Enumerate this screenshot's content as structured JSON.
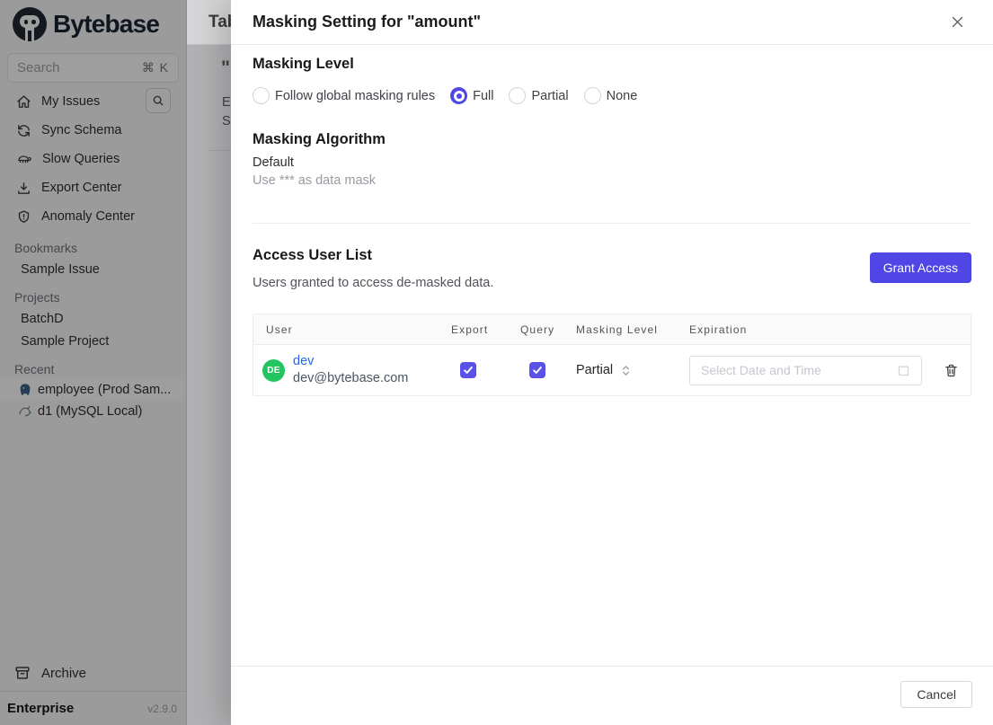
{
  "colors": {
    "accent": "#4f46e5",
    "checkbox": "#5a51e8",
    "link_blue": "#2563eb",
    "avatar_green": "#22c55e",
    "postgres_blue": "#39618d",
    "mysql_teal": "#5b7a8c"
  },
  "sidebar": {
    "logo_text": "Bytebase",
    "search": {
      "placeholder": "Search",
      "shortcut": "⌘ K"
    },
    "menu": [
      {
        "label": "My Issues",
        "icon": "home-icon"
      },
      {
        "label": "Sync Schema",
        "icon": "sync-icon"
      },
      {
        "label": "Slow Queries",
        "icon": "turtle-icon"
      },
      {
        "label": "Export Center",
        "icon": "download-icon"
      },
      {
        "label": "Anomaly Center",
        "icon": "shield-icon"
      }
    ],
    "bookmarks_label": "Bookmarks",
    "bookmarks": [
      {
        "label": "Sample Issue"
      }
    ],
    "projects_label": "Projects",
    "projects": [
      {
        "label": "BatchD"
      },
      {
        "label": "Sample Project"
      }
    ],
    "recent_label": "Recent",
    "recent": [
      {
        "label": "employee (Prod Sam...",
        "icon": "postgres-icon",
        "selected": true
      },
      {
        "label": "d1 (MySQL Local)",
        "icon": "mysql-icon",
        "selected": false
      }
    ],
    "archive_label": "Archive",
    "plan": "Enterprise",
    "version": "v2.9.0"
  },
  "background_page": {
    "title_fragment": "Tab",
    "quote_fragment": "\"",
    "line2_fragment": "E",
    "line3_fragment": "S"
  },
  "dialog": {
    "title": "Masking Setting for \"amount\"",
    "masking_level": {
      "heading": "Masking Level",
      "options": [
        {
          "label": "Follow global masking rules",
          "selected": false
        },
        {
          "label": "Full",
          "selected": true
        },
        {
          "label": "Partial",
          "selected": false
        },
        {
          "label": "None",
          "selected": false
        }
      ]
    },
    "masking_algorithm": {
      "heading": "Masking Algorithm",
      "name": "Default",
      "description": "Use *** as data mask"
    },
    "access_user_list": {
      "heading": "Access User List",
      "subtitle": "Users granted to access de-masked data.",
      "grant_button": "Grant Access",
      "table": {
        "columns": [
          "User",
          "Export",
          "Query",
          "Masking Level",
          "Expiration"
        ],
        "rows": [
          {
            "avatar": "DE",
            "name": "dev",
            "email": "dev@bytebase.com",
            "export_checked": true,
            "query_checked": true,
            "masking_level": "Partial",
            "expiration_placeholder": "Select Date and Time"
          }
        ]
      }
    },
    "footer": {
      "cancel_label": "Cancel"
    }
  }
}
